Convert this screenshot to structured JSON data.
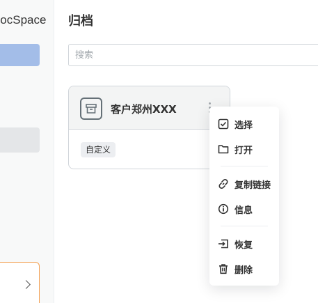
{
  "sidebar": {
    "brand_text": "DocSpace"
  },
  "header": {
    "title": "归档"
  },
  "search": {
    "placeholder": "搜索",
    "value": ""
  },
  "room_card": {
    "title": "客户郑州XXX",
    "tag": "自定义",
    "icon": "archive-room-icon"
  },
  "context_menu": {
    "items": [
      {
        "label": "选择",
        "icon": "check-square-icon"
      },
      {
        "label": "打开",
        "icon": "folder-icon"
      },
      {
        "label": "复制链接",
        "icon": "link-icon"
      },
      {
        "label": "信息",
        "icon": "info-icon"
      },
      {
        "label": "恢复",
        "icon": "restore-icon"
      },
      {
        "label": "删除",
        "icon": "trash-icon"
      }
    ]
  },
  "colors": {
    "accent": "#a3bde8",
    "sidebar_bg": "#f8f9f9",
    "border": "#d0d5da",
    "highlight_border": "#f2a154"
  }
}
